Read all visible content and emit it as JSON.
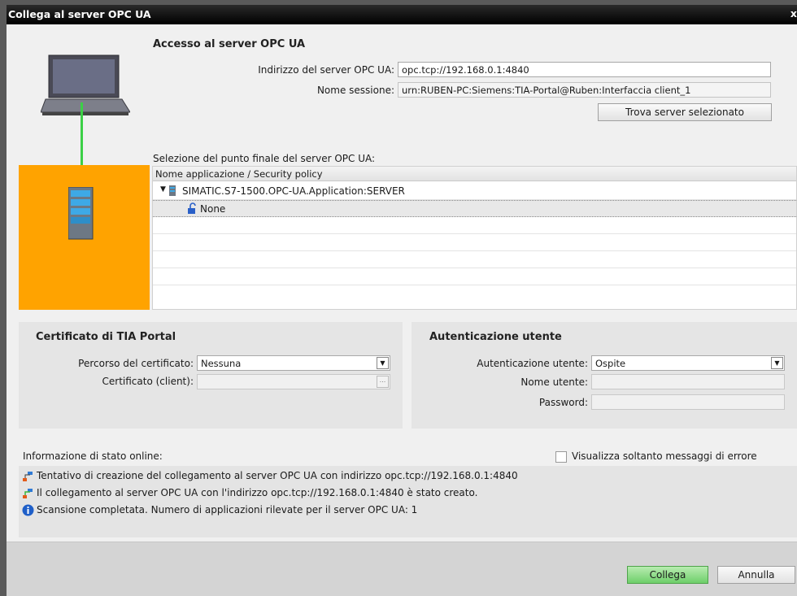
{
  "dialog": {
    "title": "Collega al server OPC UA",
    "close_glyph": "x"
  },
  "access": {
    "title": "Accesso al server OPC UA",
    "address_label": "Indirizzo del server OPC UA:",
    "address_value": "opc.tcp://192.168.0.1:4840",
    "session_label": "Nome sessione:",
    "session_value": "urn:RUBEN-PC:Siemens:TIA-Portal@Ruben:Interfaccia client_1",
    "find_button": "Trova server selezionato"
  },
  "endpoint": {
    "title": "Selezione del punto finale del server OPC UA:",
    "column_header": "Nome applicazione / Security policy",
    "rows": [
      {
        "label": "SIMATIC.S7-1500.OPC-UA.Application:SERVER",
        "icon": "server-icon",
        "expanded": true
      },
      {
        "label": "None",
        "icon": "unlocked-icon",
        "selected": true
      }
    ]
  },
  "certificate": {
    "title": "Certificato di TIA Portal",
    "path_label": "Percorso del certificato:",
    "path_value": "Nessuna",
    "client_label": "Certificato (client):",
    "client_value": "",
    "browse_label": "..."
  },
  "auth": {
    "title": "Autenticazione utente",
    "auth_label": "Autenticazione utente:",
    "auth_value": "Ospite",
    "user_label": "Nome utente:",
    "user_value": "",
    "password_label": "Password:",
    "password_value": ""
  },
  "status": {
    "title": "Informazione di stato online:",
    "errors_only_label": "Visualizza soltanto messaggi di errore",
    "errors_only_checked": false,
    "messages": [
      {
        "icon": "connection-icon",
        "text": "Tentativo di creazione del collegamento al server OPC UA con indirizzo opc.tcp://192.168.0.1:4840"
      },
      {
        "icon": "connection-icon",
        "text": "Il collegamento al server OPC UA con l'indirizzo opc.tcp://192.168.0.1:4840 è stato creato."
      },
      {
        "icon": "info-icon",
        "text": "Scansione completata. Numero di applicazioni rilevate per il server OPC UA: 1"
      }
    ]
  },
  "footer": {
    "connect_button": "Collega",
    "cancel_button": "Annulla"
  },
  "colors": {
    "accent_orange": "#ffa300",
    "link_green": "#3cd046",
    "primary_button": "#6ecf6a"
  }
}
